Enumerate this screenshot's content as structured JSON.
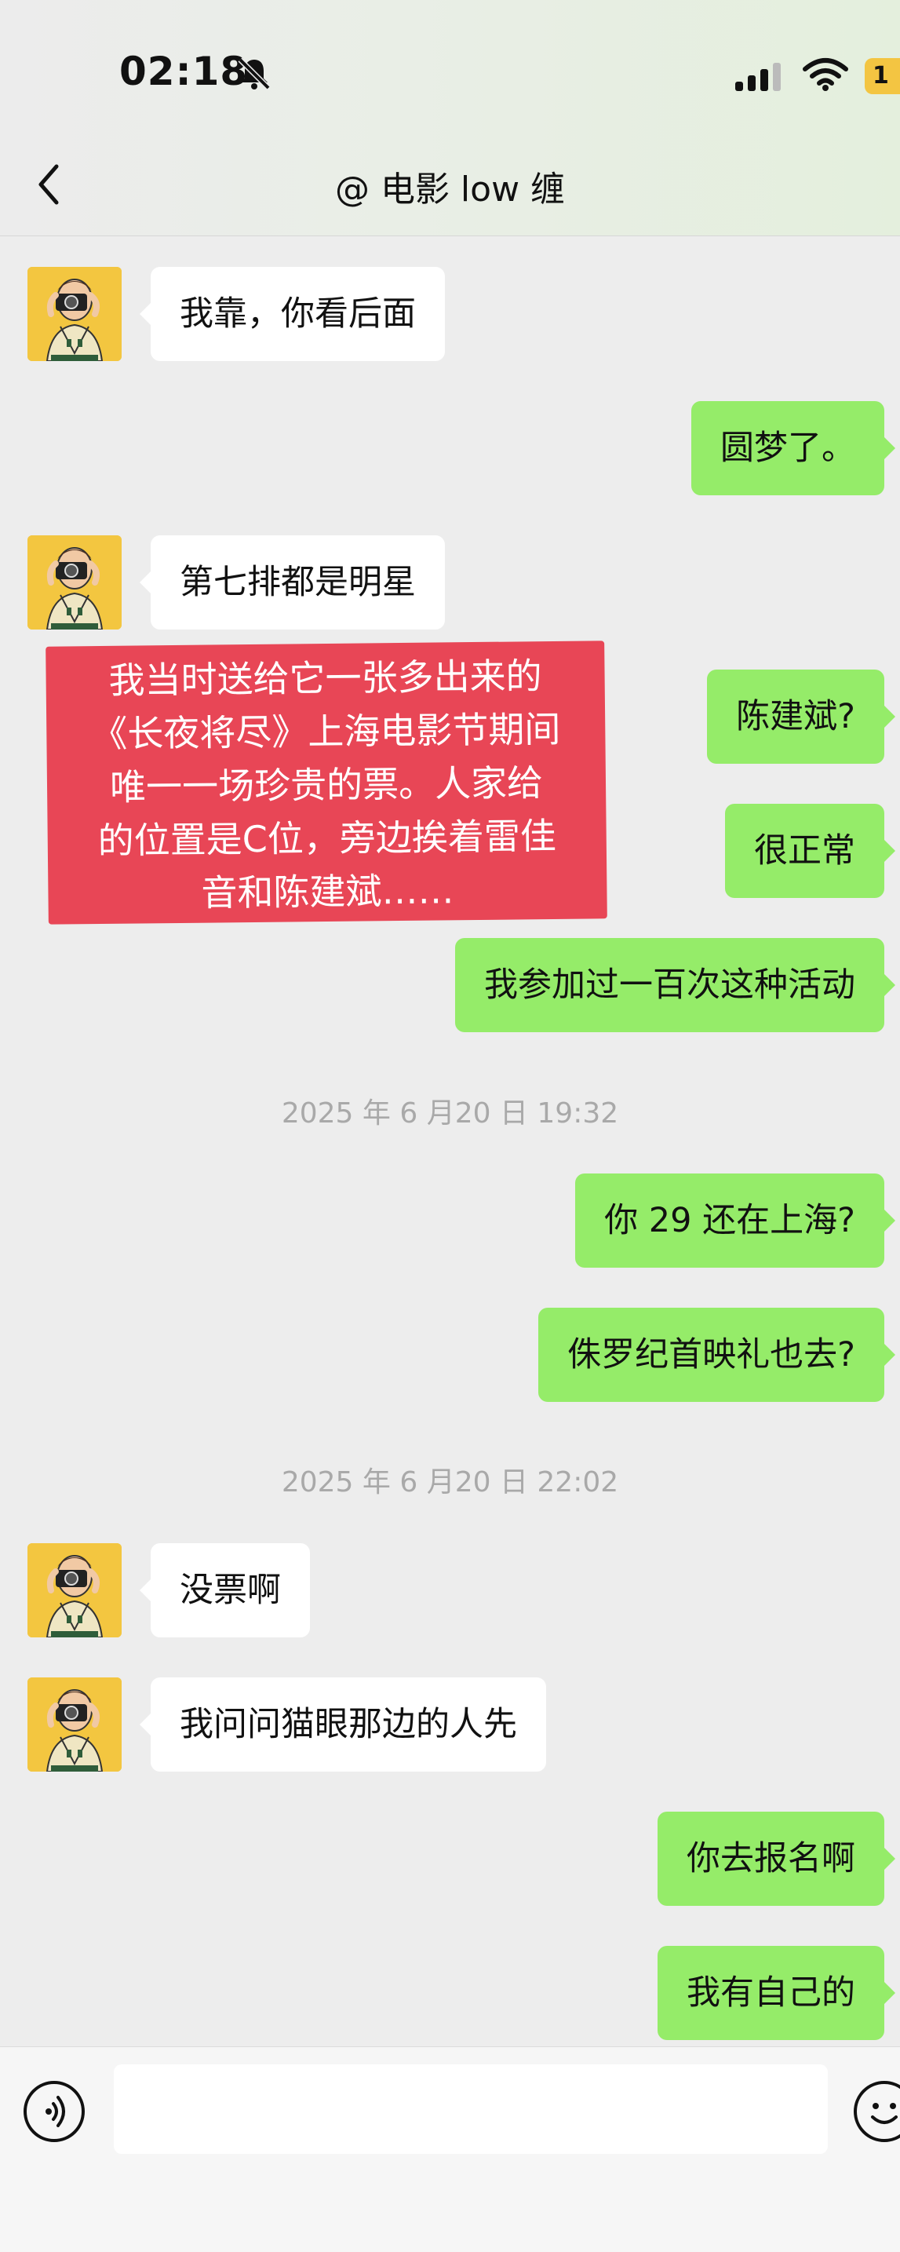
{
  "status_bar": {
    "time": "02:18",
    "battery": "1"
  },
  "header": {
    "title": "@ 电影 low 缠"
  },
  "messages": [
    {
      "text": "我靠，你看后面"
    },
    {
      "text": "圆梦了。"
    },
    {
      "text": "第七排都是明星"
    },
    {
      "text": "陈建斌?"
    },
    {
      "text": "很正常"
    },
    {
      "text": "我参加过一百次这种活动"
    },
    {
      "text": "你 29 还在上海?"
    },
    {
      "text": "侏罗纪首映礼也去?"
    },
    {
      "text": "没票啊"
    },
    {
      "text": "我问问猫眼那边的人先"
    },
    {
      "text": "你去报名啊"
    },
    {
      "text": "我有自己的"
    }
  ],
  "timestamps": [
    "2025 年 6 月20 日 19:32",
    "2025 年 6 月20 日 22:02"
  ],
  "overlay": {
    "lines": [
      "我当时送给它一张多出来的",
      "《长夜将尽》上海电影节期间",
      "唯一一场珍贵的票。人家给",
      "的位置是C位，旁边挨着雷佳",
      "音和陈建斌……"
    ]
  },
  "input": {
    "value": ""
  },
  "colors": {
    "sent_bubble": "#95ec69",
    "received_bubble": "#ffffff",
    "overlay": "#e84656",
    "background": "#ededed"
  }
}
